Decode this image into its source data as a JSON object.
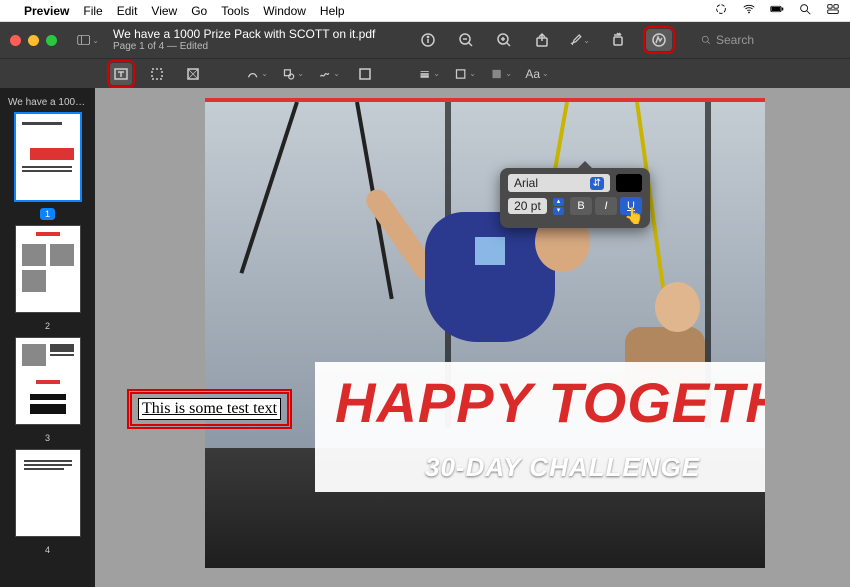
{
  "menubar": {
    "app": "Preview",
    "items": [
      "File",
      "Edit",
      "View",
      "Go",
      "Tools",
      "Window",
      "Help"
    ]
  },
  "window": {
    "title": "We have a 1000 Prize Pack with SCOTT on it.pdf",
    "subtitle": "Page 1 of 4  —  Edited",
    "search_placeholder": "Search"
  },
  "markup": {
    "font_menu_label": "Aa"
  },
  "sidebar": {
    "label": "We have a 100…",
    "pages": [
      {
        "num": "1",
        "selected": true
      },
      {
        "num": "2",
        "selected": false
      },
      {
        "num": "3",
        "selected": false
      },
      {
        "num": "4",
        "selected": false
      }
    ]
  },
  "document": {
    "headline": "HAPPY TOGETHER",
    "subhead": "30-DAY CHALLENGE",
    "annotation_text": "This is some test text"
  },
  "font_popover": {
    "font_name": "Arial",
    "size": "20 pt",
    "bold_label": "B",
    "italic_label": "I",
    "underline_label": "U",
    "underline_active": true
  }
}
